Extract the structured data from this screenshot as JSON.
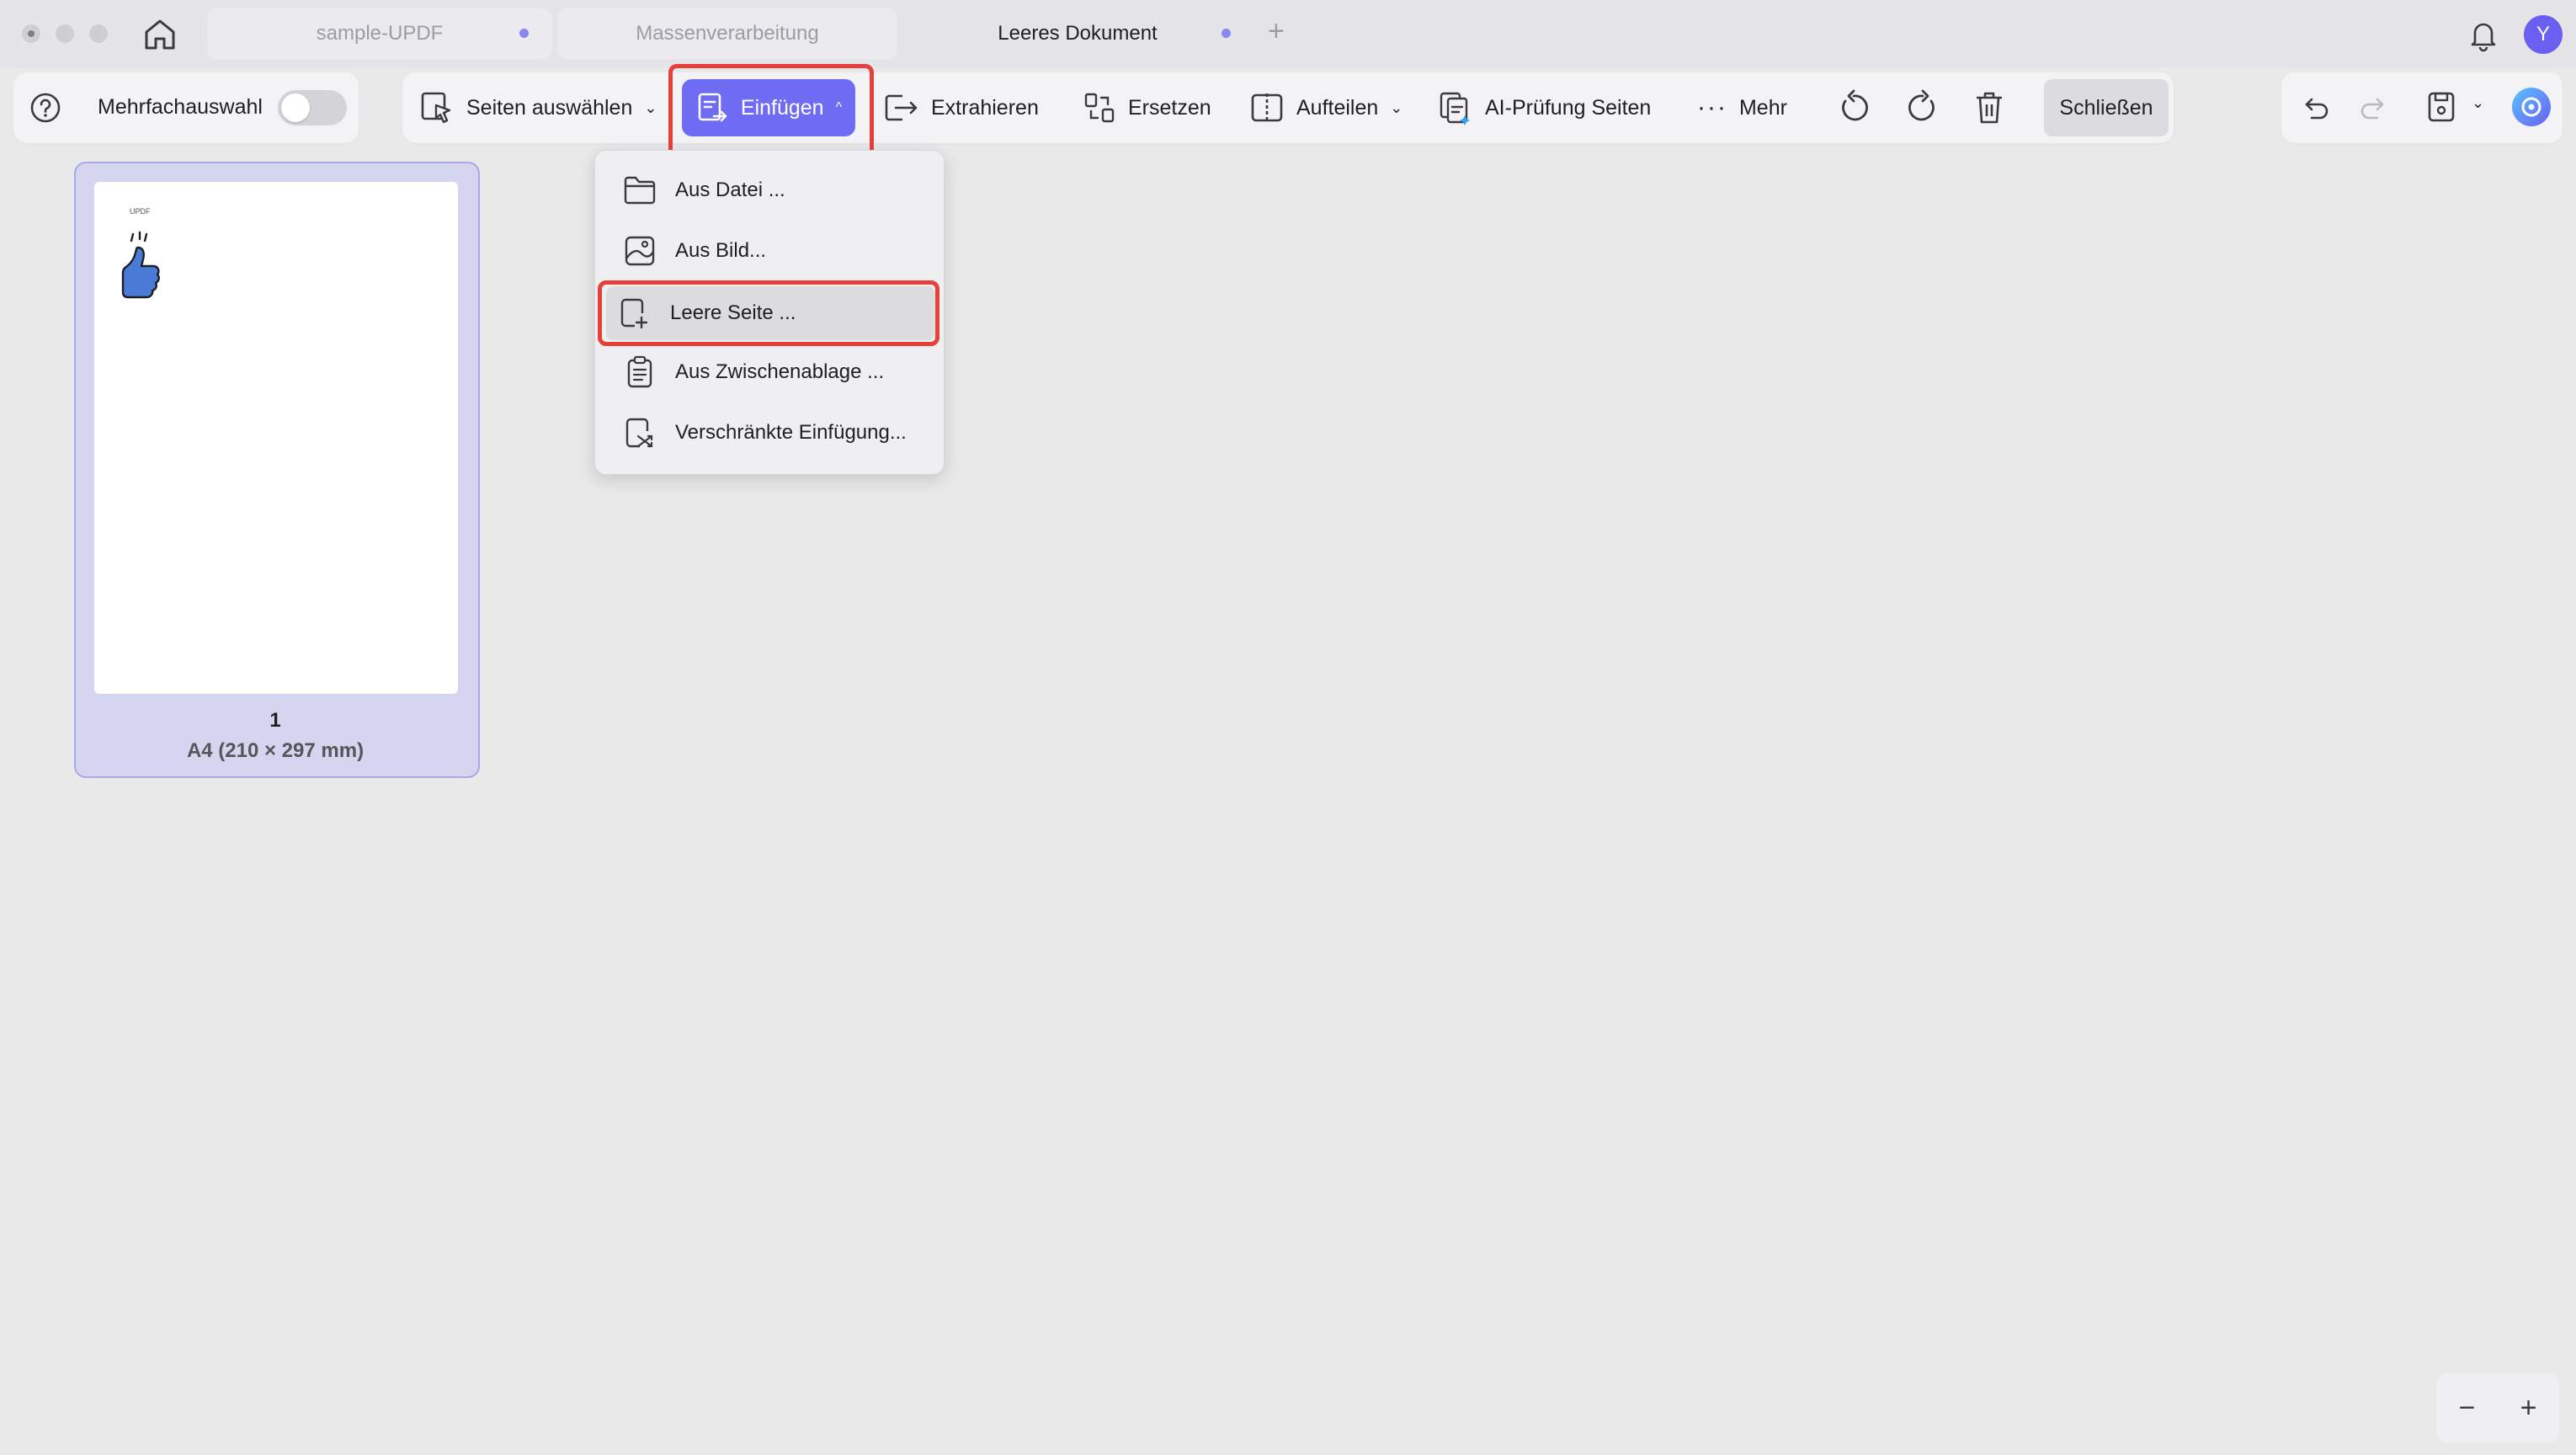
{
  "tabs": [
    {
      "label": "sample-UPDF"
    },
    {
      "label": "Massenverarbeitung"
    },
    {
      "label": "Leeres Dokument"
    }
  ],
  "user": {
    "avatar_initial": "Y"
  },
  "toolbar": {
    "multi_select_label": "Mehrfachauswahl",
    "select_pages_label": "Seiten auswählen",
    "insert_label": "Einfügen",
    "extract_label": "Extrahieren",
    "replace_label": "Ersetzen",
    "split_label": "Aufteilen",
    "ai_check_label": "AI-Prüfung Seiten",
    "more_label": "Mehr",
    "close_label": "Schließen"
  },
  "insert_menu": {
    "items": [
      {
        "label": "Aus Datei ..."
      },
      {
        "label": "Aus Bild..."
      },
      {
        "label": "Leere Seite ..."
      },
      {
        "label": "Aus Zwischenablage ..."
      },
      {
        "label": "Verschränkte Einfügung..."
      }
    ],
    "highlighted_item": "Leere Seite ..."
  },
  "page_thumb": {
    "logo_text": "UPDF",
    "page_number": "1",
    "page_size": "A4 (210 × 297 mm)"
  },
  "zoom": {
    "minus": "−",
    "plus": "+"
  },
  "colors": {
    "accent": "#6f6bf3",
    "annotation_red": "#e6403a",
    "selection_fill": "#d6d5ef"
  }
}
